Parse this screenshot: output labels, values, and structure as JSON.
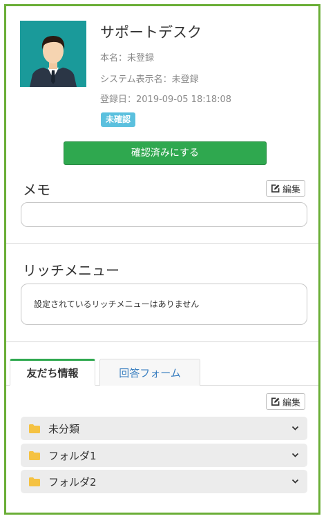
{
  "profile": {
    "name": "サポートデスク",
    "real_name": "本名：未登録",
    "display_name": "システム表示名：未登録",
    "registered": "登録日：2019-09-05 18:18:08",
    "status_badge": "未確認",
    "confirm_button": "確認済みにする"
  },
  "memo": {
    "title": "メモ",
    "edit_label": "編集",
    "value": ""
  },
  "rich_menu": {
    "title": "リッチメニュー",
    "empty_text": "設定されているリッチメニューはありません"
  },
  "tabs": [
    {
      "label": "友だち情報",
      "active": true
    },
    {
      "label": "回答フォーム",
      "active": false
    }
  ],
  "friend_info": {
    "edit_label": "編集",
    "folders": [
      {
        "label": "未分類"
      },
      {
        "label": "フォルダ1"
      },
      {
        "label": "フォルダ2"
      }
    ]
  },
  "colors": {
    "frame": "#6aae36",
    "accent_green": "#2fa84f",
    "badge": "#5bc0de",
    "link_blue": "#3a7fc0",
    "folder_icon": "#f5c242"
  }
}
